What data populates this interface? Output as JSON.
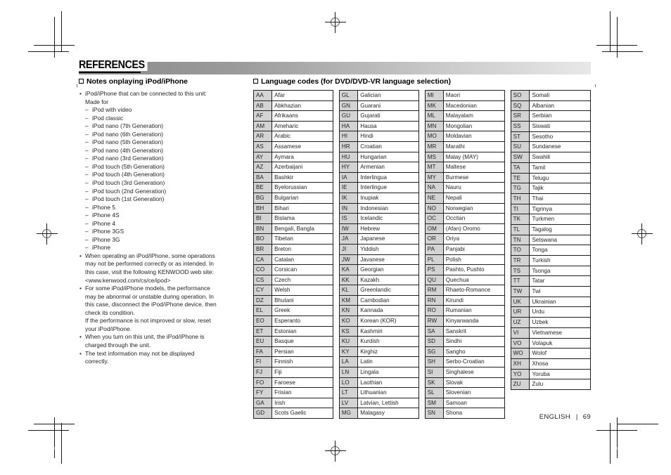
{
  "header": {
    "chapter": "REFERENCES"
  },
  "left_section": {
    "heading": "Notes onplaying iPod/iPhone",
    "bullets": [
      {
        "lines": [
          "iPod/iPhone that can be connected to this unit:",
          "Made for"
        ],
        "sub": [
          "iPod with video",
          "iPod classic",
          "iPod nano (7th Generation)",
          "iPod nano (6th Generation)",
          "iPod nano (5th Generation)",
          "iPod nano (4th Generation)",
          "iPod nano (3rd Generation)",
          "iPod touch (5th Generation)",
          "iPod touch (4th Generation)",
          "iPod touch (3rd Generation)",
          "iPod touch (2nd Generation)",
          "iPod touch (1st Generation)",
          "iPhone 5",
          "iPhone 4S",
          "iPhone 4",
          "iPhone 3GS",
          "iPhone 3G",
          "iPhone"
        ]
      },
      {
        "lines": [
          "When operating an iPod/iPhone, some operations",
          "may not be performed correctly or as intended. In",
          "this case, visit the following KENWOOD web site:",
          "<www.kenwood.com/cs/ce/ipod>"
        ],
        "sub": []
      },
      {
        "lines": [
          "For some iPod/iPhone models, the performance",
          "may be abnormal or unstable during operation. In",
          "this case, disconnect the iPod/iPhone device, then",
          "check its condition.",
          "If the performance is not improved or slow, reset",
          "your iPod/iPhone."
        ],
        "sub": []
      },
      {
        "lines": [
          "When you turn on this unit, the iPod/iPhone is",
          "charged through the unit."
        ],
        "sub": []
      },
      {
        "lines": [
          "The text information may not be displayed",
          "correctly."
        ],
        "sub": []
      }
    ]
  },
  "right_section": {
    "heading": "Language codes (for DVD/DVD-VR language selection)",
    "table_columns": [
      [
        [
          "AA",
          "Afar"
        ],
        [
          "AB",
          "Abkhazian"
        ],
        [
          "AF",
          "Afrikaans"
        ],
        [
          "AM",
          "Ameharic"
        ],
        [
          "AR",
          "Arabic"
        ],
        [
          "AS",
          "Assamese"
        ],
        [
          "AY",
          "Aymara"
        ],
        [
          "AZ",
          "Azerbaijani"
        ],
        [
          "BA",
          "Bashkir"
        ],
        [
          "BE",
          "Byelorussian"
        ],
        [
          "BG",
          "Bulgarian"
        ],
        [
          "BH",
          "Bihari"
        ],
        [
          "BI",
          "Bislama"
        ],
        [
          "BN",
          "Bengali, Bangla"
        ],
        [
          "BO",
          "Tibetan"
        ],
        [
          "BR",
          "Breton"
        ],
        [
          "CA",
          "Catalan"
        ],
        [
          "CO",
          "Corsican"
        ],
        [
          "CS",
          "Czech"
        ],
        [
          "CY",
          "Welsh"
        ],
        [
          "DZ",
          "Bhutani"
        ],
        [
          "EL",
          "Greek"
        ],
        [
          "EO",
          "Esperanto"
        ],
        [
          "ET",
          "Estonian"
        ],
        [
          "EU",
          "Basque"
        ],
        [
          "FA",
          "Persian"
        ],
        [
          "FI",
          "Finnish"
        ],
        [
          "FJ",
          "Fiji"
        ],
        [
          "FO",
          "Faroese"
        ],
        [
          "FY",
          "Frisian"
        ],
        [
          "GA",
          "Irish"
        ],
        [
          "GD",
          "Scots Gaelic"
        ]
      ],
      [
        [
          "GL",
          "Galician"
        ],
        [
          "GN",
          "Guarani"
        ],
        [
          "GU",
          "Gujarati"
        ],
        [
          "HA",
          "Hausa"
        ],
        [
          "HI",
          "Hindi"
        ],
        [
          "HR",
          "Croatian"
        ],
        [
          "HU",
          "Hungarian"
        ],
        [
          "HY",
          "Armenian"
        ],
        [
          "IA",
          "Interlingua"
        ],
        [
          "IE",
          "Interlingue"
        ],
        [
          "IK",
          "Inupiak"
        ],
        [
          "IN",
          "Indonesian"
        ],
        [
          "IS",
          "Icelandic"
        ],
        [
          "IW",
          "Hebrew"
        ],
        [
          "JA",
          "Japanese"
        ],
        [
          "JI",
          "Yiddish"
        ],
        [
          "JW",
          "Javanese"
        ],
        [
          "KA",
          "Georgian"
        ],
        [
          "KK",
          "Kazakh"
        ],
        [
          "KL",
          "Greenlandic"
        ],
        [
          "KM",
          "Cambodian"
        ],
        [
          "KN",
          "Kannada"
        ],
        [
          "KO",
          "Korean (KOR)"
        ],
        [
          "KS",
          "Kashmiri"
        ],
        [
          "KU",
          "Kurdish"
        ],
        [
          "KY",
          "Kirghiz"
        ],
        [
          "LA",
          "Latin"
        ],
        [
          "LN",
          "Lingala"
        ],
        [
          "LO",
          "Laothian"
        ],
        [
          "LT",
          "Lithuanian"
        ],
        [
          "LV",
          "Latvian, Lettish"
        ],
        [
          "MG",
          "Malagasy"
        ]
      ],
      [
        [
          "MI",
          "Maori"
        ],
        [
          "MK",
          "Macedonian"
        ],
        [
          "ML",
          "Malayalam"
        ],
        [
          "MN",
          "Mongolian"
        ],
        [
          "MO",
          "Moldavian"
        ],
        [
          "MR",
          "Marathi"
        ],
        [
          "MS",
          "Malay (MAY)"
        ],
        [
          "MT",
          "Maltese"
        ],
        [
          "MY",
          "Burmese"
        ],
        [
          "NA",
          "Nauru"
        ],
        [
          "NE",
          "Nepali"
        ],
        [
          "NO",
          "Norwegian"
        ],
        [
          "OC",
          "Occitan"
        ],
        [
          "OM",
          "(Afan) Oromo"
        ],
        [
          "OR",
          "Oriya"
        ],
        [
          "PA",
          "Panjabi"
        ],
        [
          "PL",
          "Polish"
        ],
        [
          "PS",
          "Pashto, Pushto"
        ],
        [
          "QU",
          "Quechua"
        ],
        [
          "RM",
          "Rhaeto-Romance"
        ],
        [
          "RN",
          "Kirundi"
        ],
        [
          "RO",
          "Rumanian"
        ],
        [
          "RW",
          "Kinyarwanda"
        ],
        [
          "SA",
          "Sanskrit"
        ],
        [
          "SD",
          "Sindhi"
        ],
        [
          "SG",
          "Sangho"
        ],
        [
          "SH",
          "Serbo-Croatian"
        ],
        [
          "SI",
          "Singhalese"
        ],
        [
          "SK",
          "Slovak"
        ],
        [
          "SL",
          "Slovenian"
        ],
        [
          "SM",
          "Samoan"
        ],
        [
          "SN",
          "Shona"
        ]
      ],
      [
        [
          "SO",
          "Somali"
        ],
        [
          "SQ",
          "Albanian"
        ],
        [
          "SR",
          "Serbian"
        ],
        [
          "SS",
          "Siswati"
        ],
        [
          "ST",
          "Sesotho"
        ],
        [
          "SU",
          "Sundanese"
        ],
        [
          "SW",
          "Swahili"
        ],
        [
          "TA",
          "Tamil"
        ],
        [
          "TE",
          "Telugu"
        ],
        [
          "TG",
          "Tajik"
        ],
        [
          "TH",
          "Thai"
        ],
        [
          "TI",
          "Tigrinya"
        ],
        [
          "TK",
          "Turkmen"
        ],
        [
          "TL",
          "Tagalog"
        ],
        [
          "TN",
          "Setswana"
        ],
        [
          "TO",
          "Tonga"
        ],
        [
          "TR",
          "Turkish"
        ],
        [
          "TS",
          "Tsonga"
        ],
        [
          "TT",
          "Tatar"
        ],
        [
          "TW",
          "Twi"
        ],
        [
          "UK",
          "Ukrainian"
        ],
        [
          "UR",
          "Urdu"
        ],
        [
          "UZ",
          "Uzbek"
        ],
        [
          "VI",
          "Vietnamese"
        ],
        [
          "VO",
          "Volapuk"
        ],
        [
          "WO",
          "Wolof"
        ],
        [
          "XH",
          "Xhosa"
        ],
        [
          "YO",
          "Yoruba"
        ],
        [
          "ZU",
          "Zulu"
        ]
      ]
    ]
  },
  "footer": {
    "language": "ENGLISH",
    "separator": "|",
    "page_number": "69"
  },
  "colors": {
    "code_cell_fill": "#d3d3d3",
    "rule_dark": "#8c8c8c",
    "rule_light": "#e8e8e8",
    "text": "#231f20"
  }
}
